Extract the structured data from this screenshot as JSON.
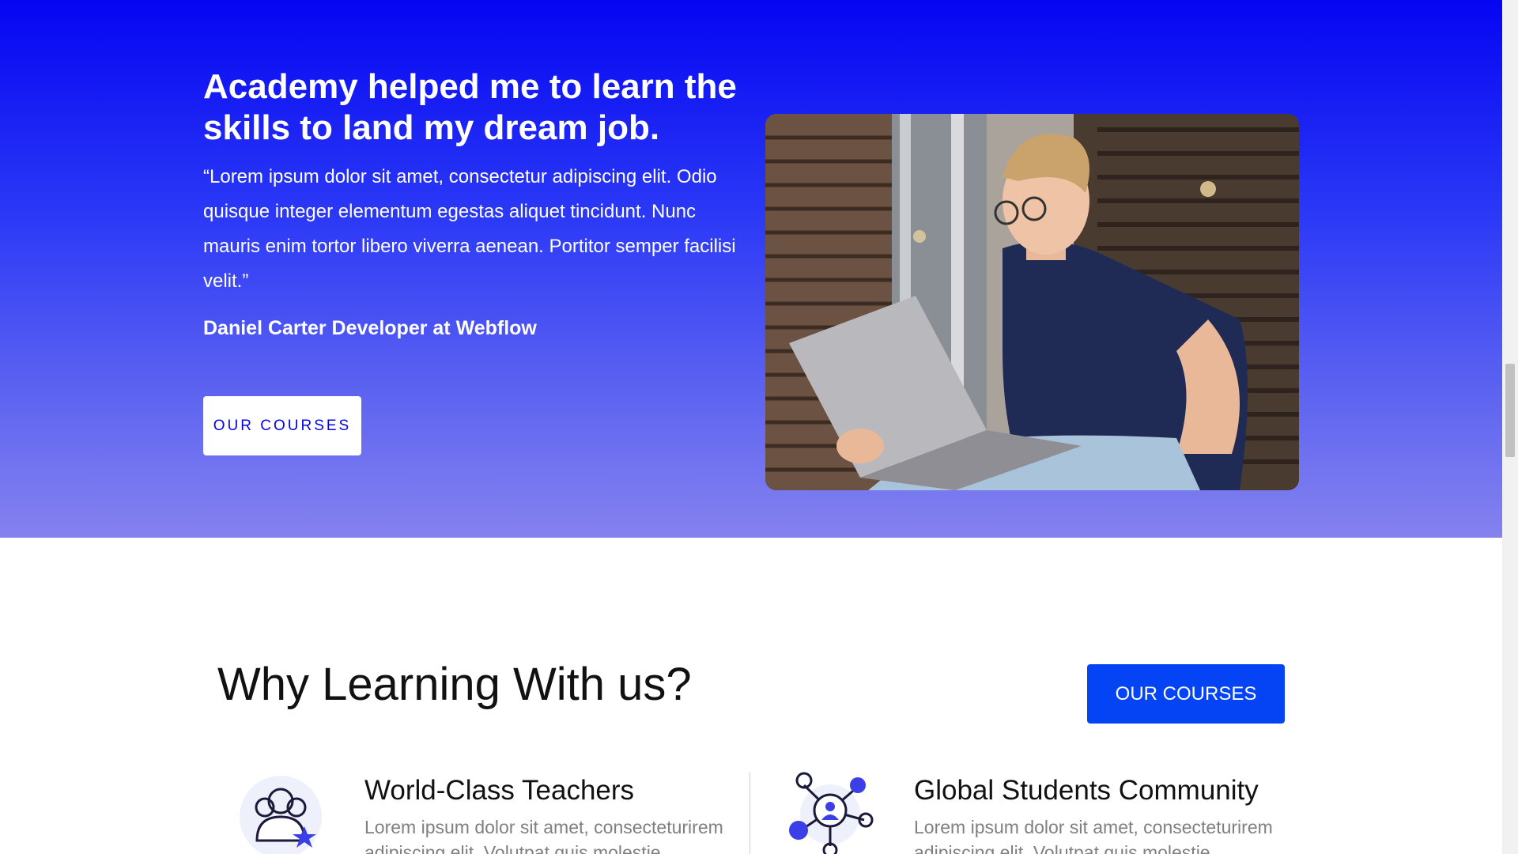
{
  "hero": {
    "heading": "Academy helped me to learn the skills to land my dream job.",
    "quote": "“Lorem ipsum dolor sit amet, consectetur adipiscing elit. Odio quisque integer elementum egestas aliquet tincidunt. Nunc mauris enim tortor libero viverra aenean. Portitor semper facilisi velit.”",
    "author": "Daniel Carter Developer at Webflow",
    "button_label": "OUR COURSES"
  },
  "why": {
    "title": "Why Learning With us?",
    "button_label": "OUR COURSES",
    "features": [
      {
        "title": "World-Class Teachers",
        "description": "Lorem ipsum dolor sit amet, consecteturirem adipiscing elit. Volutpat quis molestie",
        "icon": "teachers-group-star-icon"
      },
      {
        "title": "Global Students Community",
        "description": "Lorem ipsum dolor sit amet, consecteturirem adipiscing elit. Volutpat quis molestie",
        "icon": "network-community-icon"
      }
    ]
  },
  "colors": {
    "hero_gradient_top": "#0505f2",
    "hero_gradient_bottom": "#8582ef",
    "primary_button": "#0444f4",
    "accent_icon": "#3b3fe8"
  }
}
